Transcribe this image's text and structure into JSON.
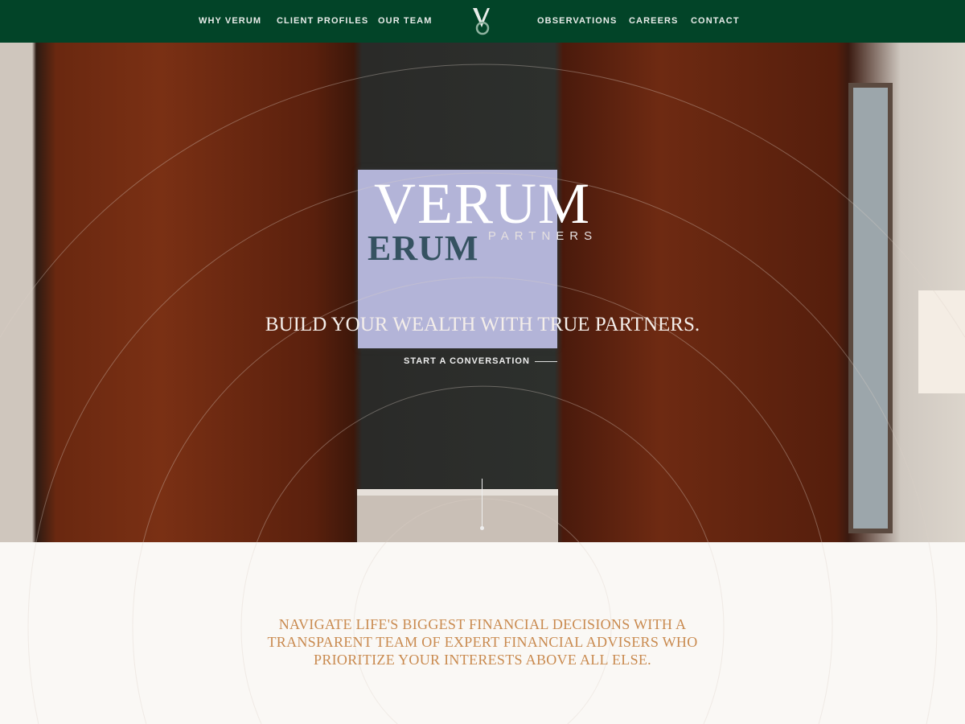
{
  "nav": {
    "left": [
      "WHY VERUM",
      "CLIENT PROFILES",
      "OUR TEAM"
    ],
    "right": [
      "OBSERVATIONS",
      "CAREERS",
      "CONTACT"
    ]
  },
  "hero": {
    "brand_name": "VERUM",
    "brand_sub": "PARTNERS",
    "screen_text": "ERUM",
    "tagline": "BUILD YOUR WEALTH WITH TRUE PARTNERS.",
    "cta": "START A CONVERSATION"
  },
  "intro": {
    "lines": [
      "NAVIGATE LIFE'S BIGGEST FINANCIAL DECISIONS WITH A",
      "TRANSPARENT TEAM OF EXPERT FINANCIAL ADVISERS WHO",
      "PRIORITIZE YOUR INTERESTS ABOVE ALL ELSE."
    ]
  },
  "colors": {
    "nav": "#024428",
    "accent": "#c98a4f",
    "background": "#faf8f5"
  }
}
